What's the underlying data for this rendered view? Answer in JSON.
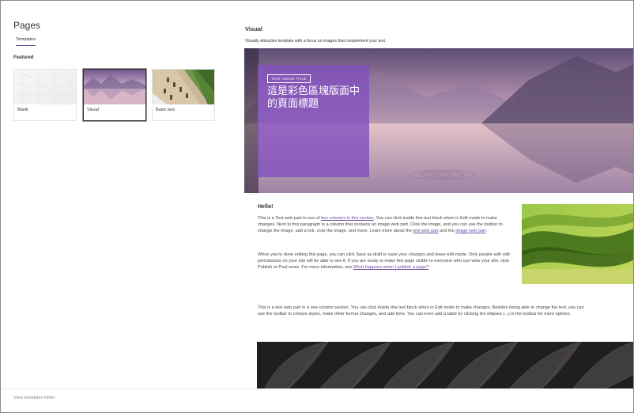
{
  "panel": {
    "title": "Pages",
    "tab_label": "Templates",
    "section_label": "Featured",
    "templates": [
      {
        "label": "Blank"
      },
      {
        "label": "Visual"
      },
      {
        "label": "Basic text"
      }
    ],
    "selected_template": "Visual",
    "footer_link": "View templates folder"
  },
  "preview": {
    "title": "Visual",
    "description": "Visually attractive template with a focus on images that complement your text.",
    "hero": {
      "chip": "TEXT ABOVE TITLE",
      "heading": "這是彩色區塊版面中的頁面標題"
    },
    "hello": "Hello!",
    "para1": {
      "t1": "This is a Text web part in one of ",
      "link1": "two columns in this section",
      "t2": ". You can click inside this text block when in Edit mode to make changes. Next to this paragraph is a column that contains an image web part. Click the image, and you can use the toolbar to change the image, add a link, crop the image, and more. Learn more about the ",
      "link2": "text web part",
      "t3": " and the ",
      "link3": "image web part",
      "t4": "."
    },
    "para2": {
      "t1": "When you're done editing this page, you can click Save as draft to save your changes and leave edit mode. Only people with edit permissions on your site will be able to see it. If you are ready to make this page visible to everyone who can view your site, click Publish or Post news. For more information, see ",
      "link1": "What happens when I publish a page?"
    },
    "para3_line1": "This is a text web part in a one column section. You can click inside this text block when in Edit mode to make changes. Besides being able to change the text, you can",
    "para3_line2": "use the toolbar to choose styles, make other format changes, and add links. You can even add a table by clicking the ellipses (...) in the toolbar for more options."
  },
  "colors": {
    "accent": "#6b4ea0",
    "hero_box": "#8250be"
  }
}
